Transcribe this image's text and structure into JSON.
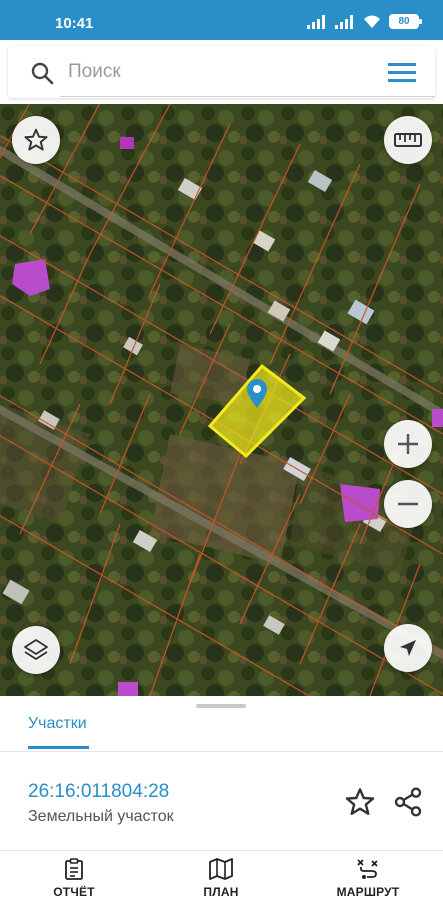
{
  "status_bar": {
    "time": "10:41",
    "battery": "80"
  },
  "search": {
    "placeholder": "Поиск"
  },
  "sheet": {
    "tab_label": "Участки",
    "parcel_id": "26:16:011804:28",
    "parcel_type": "Земельный участок"
  },
  "bottom_nav": {
    "items": [
      {
        "label": "ОТЧЁТ",
        "icon": "report-icon"
      },
      {
        "label": "ПЛАН",
        "icon": "map-plan-icon"
      },
      {
        "label": "МАРШРУТ",
        "icon": "route-icon"
      }
    ]
  },
  "colors": {
    "accent": "#2a8ec9",
    "parcel_highlight": "#f2ea1a",
    "parcel_borders": "#c8552a"
  }
}
